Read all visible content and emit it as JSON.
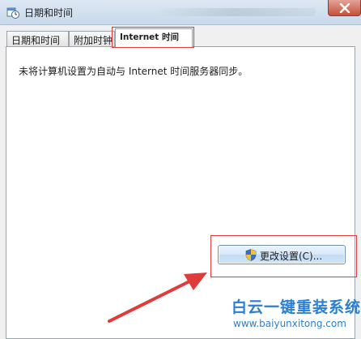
{
  "window": {
    "title": "日期和时间",
    "icon": "clock-calendar-icon",
    "close_icon": "close-icon"
  },
  "tabs": [
    {
      "label": "日期和时间",
      "active": false
    },
    {
      "label": "附加时钟",
      "active": false
    },
    {
      "label": "Internet 时间",
      "active": true
    }
  ],
  "panel": {
    "message": "未将计算机设置为自动与 Internet 时间服务器同步。"
  },
  "change_button": {
    "label": "更改设置(C)...",
    "icon": "uac-shield-icon"
  },
  "annotations": {
    "highlight_color": "#e03a3a",
    "arrow_color": "#e03a3a"
  },
  "watermark": {
    "title": "白云一键重装系统",
    "url": "www.baiyunxitong.com",
    "color": "#2a7fd0"
  }
}
